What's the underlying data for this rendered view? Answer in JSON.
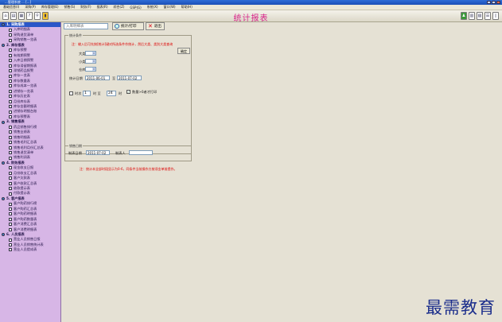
{
  "window": {
    "title": "...管理系统 ... [...]"
  },
  "menubar": [
    "基础信息(I)",
    "采购(P)",
    "库存管理(E)",
    "销售(S)",
    "财务(F)",
    "报表(R)",
    "综合(Z)",
    "GSP(G)",
    "系统(X)",
    "窗口(W)",
    "帮助(H)"
  ],
  "toolbar": {
    "title": "统计报表"
  },
  "sidebar": [
    {
      "label": "1. 采购报表",
      "type": "group",
      "selected": true
    },
    {
      "label": "入库明细表",
      "type": "child"
    },
    {
      "label": "采购退货清单",
      "type": "child"
    },
    {
      "label": "采购销售一览表",
      "type": "child"
    },
    {
      "label": "2. 库存报表",
      "type": "group"
    },
    {
      "label": "库存预警",
      "type": "child"
    },
    {
      "label": "有效期预警",
      "type": "child"
    },
    {
      "label": "入库日期预警",
      "type": "child"
    },
    {
      "label": "库存滞留期报表",
      "type": "child"
    },
    {
      "label": "滞销药品报警",
      "type": "child"
    },
    {
      "label": "库存一览表",
      "type": "child"
    },
    {
      "label": "库存数量表",
      "type": "child"
    },
    {
      "label": "库存成本一览表",
      "type": "child"
    },
    {
      "label": "进销存一览表",
      "type": "child"
    },
    {
      "label": "库存历史表",
      "type": "child"
    },
    {
      "label": "月份库存表",
      "type": "child"
    },
    {
      "label": "库存金额明细表",
      "type": "child"
    },
    {
      "label": "进销存明细台账",
      "type": "child"
    },
    {
      "label": "库存预警表",
      "type": "child"
    },
    {
      "label": "3. 销售报表",
      "type": "group"
    },
    {
      "label": "药品销售排行榜",
      "type": "child"
    },
    {
      "label": "销售业绩表",
      "type": "child"
    },
    {
      "label": "销售明细表",
      "type": "child"
    },
    {
      "label": "销售毛利汇总表",
      "type": "child"
    },
    {
      "label": "销售毛利月份汇总表",
      "type": "child"
    },
    {
      "label": "销售退货清单",
      "type": "child"
    },
    {
      "label": "销售利润表",
      "type": "child"
    },
    {
      "label": "4. 财务报表",
      "type": "group"
    },
    {
      "label": "现金收支日报",
      "type": "child"
    },
    {
      "label": "月份收支汇总表",
      "type": "child"
    },
    {
      "label": "客户欠款表",
      "type": "child"
    },
    {
      "label": "客户收款汇总表",
      "type": "child"
    },
    {
      "label": "收款提示表",
      "type": "child"
    },
    {
      "label": "付款提示表",
      "type": "child"
    },
    {
      "label": "5. 客户报表",
      "type": "group"
    },
    {
      "label": "客户购药排行榜",
      "type": "child"
    },
    {
      "label": "客户购药汇总表",
      "type": "child"
    },
    {
      "label": "客户购药明细表",
      "type": "child"
    },
    {
      "label": "客户购药数量表",
      "type": "child"
    },
    {
      "label": "客户消费汇总表",
      "type": "child"
    },
    {
      "label": "客户消费明细表",
      "type": "child"
    },
    {
      "label": "6. 人员报表",
      "type": "group"
    },
    {
      "label": "营业人员销售日报",
      "type": "child"
    },
    {
      "label": "营业人员销售统计表",
      "type": "child"
    },
    {
      "label": "营业人员提成表",
      "type": "child"
    }
  ],
  "search": {
    "placeholder": "入库明细表"
  },
  "buttons": {
    "stats_print": "统计/打印",
    "exit": "退出",
    "confirm": "确定"
  },
  "panel_top": {
    "legend": "统计条件",
    "note": "注：输入后可先按[统计]键对所选条件作统计，然后大类、类别大类查询",
    "labels": {
      "category": "大类",
      "subcategory": "小类",
      "warehouse": "仓库",
      "date_range": "统计日期",
      "to": "至"
    },
    "date_from": "2011-06-01",
    "date_to": "2011-07-02",
    "period": {
      "label": "时次",
      "from": "1",
      "sep": "时 至",
      "to": "24",
      "unit": "时"
    },
    "qty_checkbox": "数量>0者才打印"
  },
  "panel_bottom": {
    "legend": "销售日期",
    "date_label": "制表日期",
    "date_value": "2011-07-02",
    "maker_label": "制表人",
    "maker_value": ""
  },
  "note_bottom": "注：统计本全部时段显示为0-6，同条件当前操作方按须金单前提作。",
  "watermark": "最需教育",
  "colors": {
    "sidebar_bg": "#d7b6e6",
    "selected": "#2a56c8",
    "title": "#d8238a",
    "note": "#d00000"
  }
}
